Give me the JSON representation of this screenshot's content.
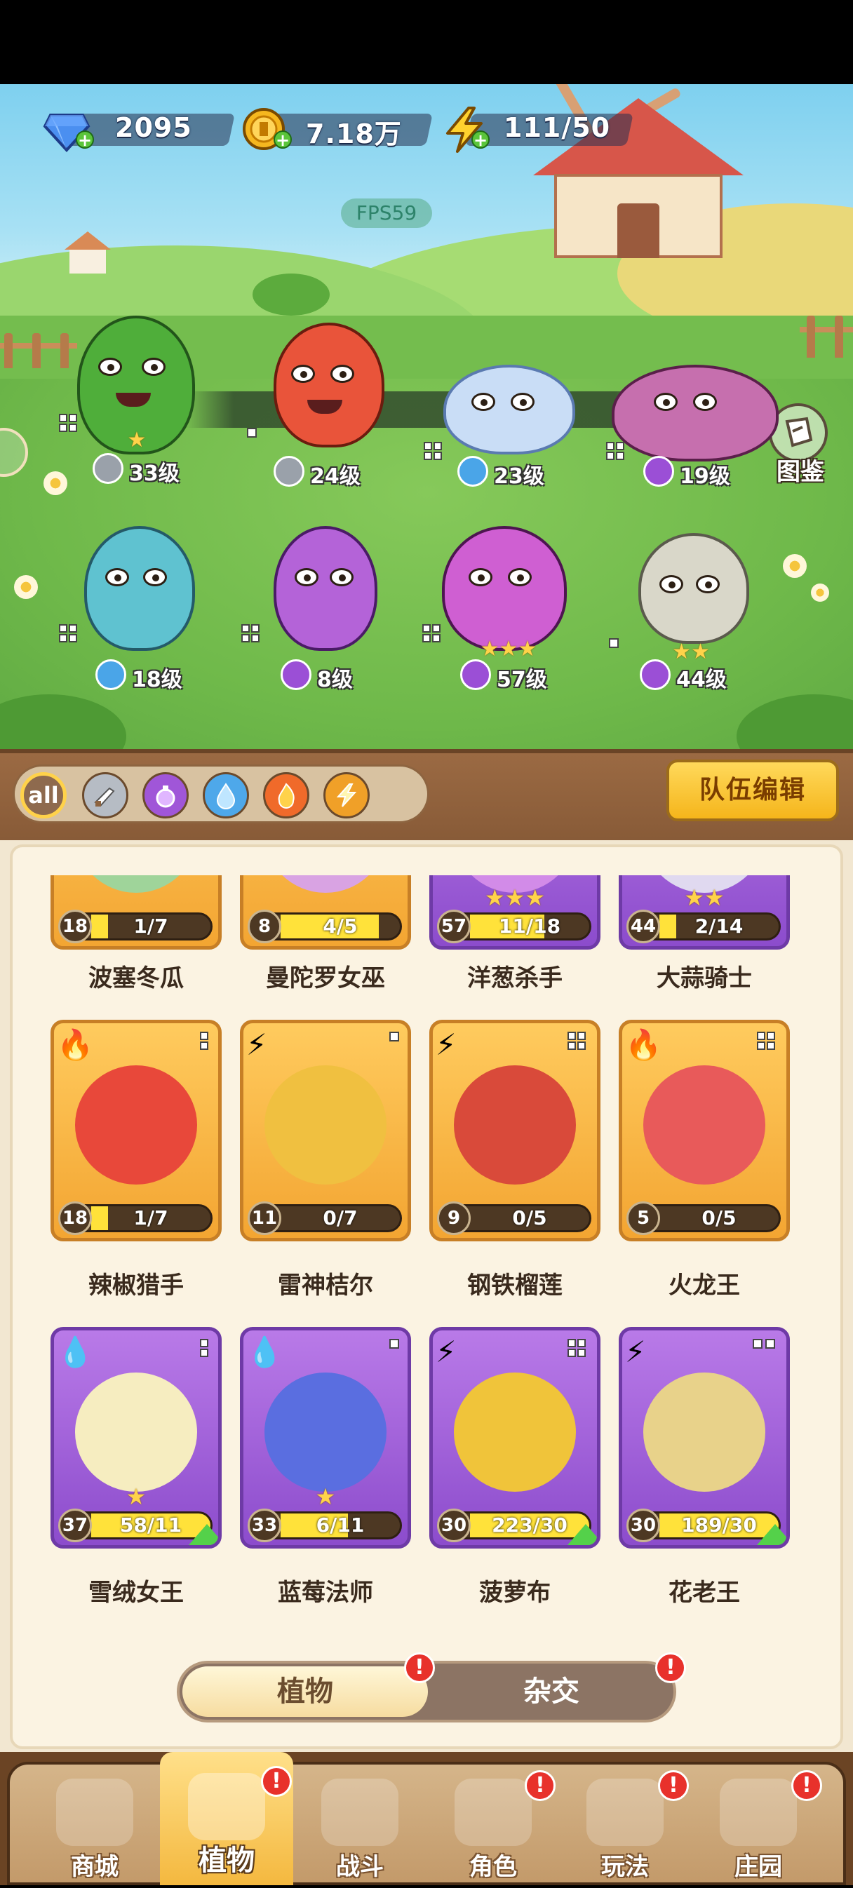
{
  "resources": {
    "gems": "2095",
    "coins": "7.18万",
    "energy": "111/50"
  },
  "fps": "FPS59",
  "atlas_label": "图鉴",
  "team_heroes": [
    {
      "level": "33级",
      "element": "sword",
      "stars": 1
    },
    {
      "level": "24级",
      "element": "sword",
      "stars": 0
    },
    {
      "level": "23级",
      "element": "water",
      "stars": 0
    },
    {
      "level": "19级",
      "element": "poison",
      "stars": 0
    },
    {
      "level": "18级",
      "element": "water",
      "stars": 0
    },
    {
      "level": "8级",
      "element": "poison",
      "stars": 0
    },
    {
      "level": "57级",
      "element": "poison",
      "stars": 3
    },
    {
      "level": "44级",
      "element": "poison",
      "stars": 2
    }
  ],
  "filters": [
    "all",
    "sword",
    "poison",
    "water",
    "fire",
    "lightning"
  ],
  "filter_all_label": "all",
  "team_edit_label": "队伍编辑",
  "cards_top_row": [
    {
      "name": "波塞冬瓜",
      "level": "18",
      "count": "1/7",
      "fill": 0.14
    },
    {
      "name": "曼陀罗女巫",
      "level": "8",
      "count": "4/5",
      "fill": 0.8
    },
    {
      "name": "洋葱杀手",
      "level": "57",
      "count": "11/18",
      "fill": 0.61,
      "stars": "★★★"
    },
    {
      "name": "大蒜骑士",
      "level": "44",
      "count": "2/14",
      "fill": 0.14,
      "stars": "★★"
    }
  ],
  "cards_row2": [
    {
      "name": "辣椒猎手",
      "level": "18",
      "count": "1/7",
      "fill": 0.14,
      "element": "fire"
    },
    {
      "name": "雷神桔尔",
      "level": "11",
      "count": "0/7",
      "fill": 0,
      "element": "lightning"
    },
    {
      "name": "钢铁榴莲",
      "level": "9",
      "count": "0/5",
      "fill": 0,
      "element": "lightning"
    },
    {
      "name": "火龙王",
      "level": "5",
      "count": "0/5",
      "fill": 0,
      "element": "fire"
    }
  ],
  "cards_row3": [
    {
      "name": "雪绒女王",
      "level": "37",
      "count": "58/11",
      "fill": 1,
      "element": "water",
      "stars": "★"
    },
    {
      "name": "蓝莓法师",
      "level": "33",
      "count": "6/11",
      "fill": 0.55,
      "element": "water",
      "stars": "★"
    },
    {
      "name": "菠萝布",
      "level": "30",
      "count": "223/30",
      "fill": 1,
      "element": "lightning"
    },
    {
      "name": "花老王",
      "level": "30",
      "count": "189/30",
      "fill": 1,
      "element": "lightning"
    }
  ],
  "toggle": {
    "active": "植物",
    "inactive": "杂交"
  },
  "alert_mark": "!",
  "nav": [
    {
      "label": "商城"
    },
    {
      "label": "植物"
    },
    {
      "label": "战斗"
    },
    {
      "label": "角色"
    },
    {
      "label": "玩法"
    },
    {
      "label": "庄园"
    }
  ]
}
